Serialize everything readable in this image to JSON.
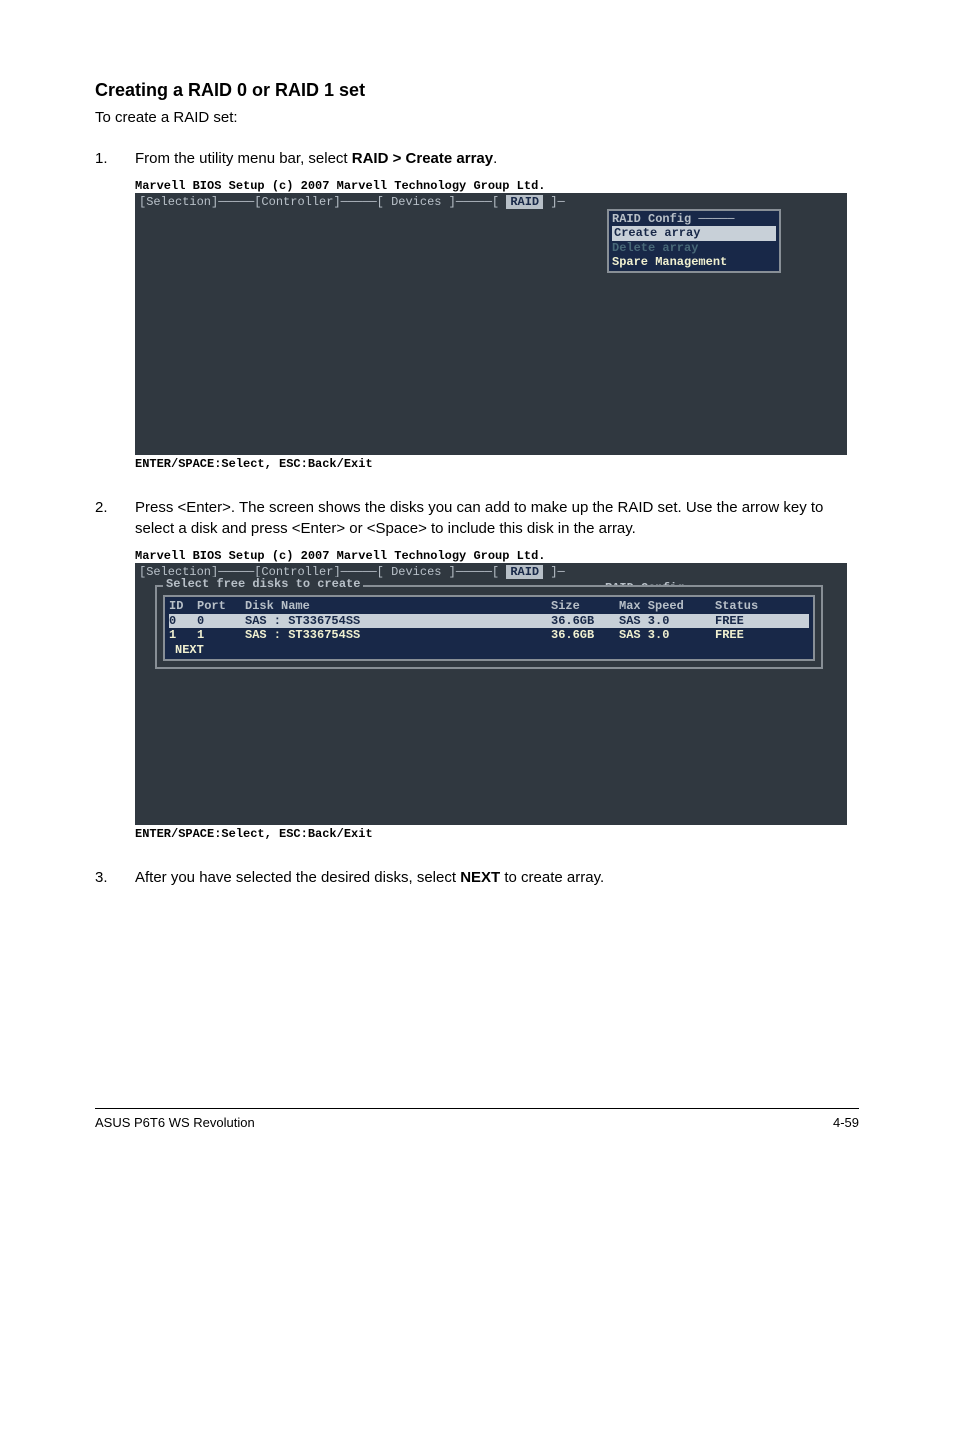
{
  "heading": "Creating a RAID 0 or RAID 1 set",
  "intro": "To create a RAID set:",
  "steps": {
    "s1": {
      "num": "1.",
      "text_before": "From the utility menu bar, select ",
      "bold": "RAID > Create array",
      "text_after": "."
    },
    "s2": {
      "num": "2.",
      "text": "Press <Enter>. The screen shows the disks you can add to make up the RAID set. Use the arrow key to select a disk and press <Enter> or <Space> to include this disk in the array."
    },
    "s3": {
      "num": "3.",
      "text_before": "After you have selected the desired disks, select ",
      "bold": "NEXT",
      "text_after": " to create array."
    }
  },
  "bios": {
    "title": "Marvell BIOS Setup (c) 2007 Marvell Technology Group Ltd.",
    "tabs": {
      "selection": "[Selection]",
      "controller": "[Controller]",
      "devices": "[ Devices ]",
      "raid": "RAID"
    },
    "raid_menu": {
      "title": "RAID Config",
      "create": "Create array",
      "delete": "Delete array",
      "spare": "Spare Management"
    },
    "select_title": "Select free disks to create",
    "disk_header": {
      "id": "ID",
      "port": "Port",
      "name": "Disk Name",
      "size": "Size",
      "speed": "Max Speed",
      "status": "Status"
    },
    "disks": [
      {
        "id": "0",
        "port": "0",
        "name": "SAS : ST336754SS",
        "size": "36.6GB",
        "speed": "SAS 3.0",
        "status": "FREE"
      },
      {
        "id": "1",
        "port": "1",
        "name": "SAS : ST336754SS",
        "size": "36.6GB",
        "speed": "SAS 3.0",
        "status": "FREE"
      }
    ],
    "next": "NEXT",
    "footer": "ENTER/SPACE:Select, ESC:Back/Exit"
  },
  "footer": {
    "left": "ASUS P6T6 WS Revolution",
    "right": "4-59"
  }
}
